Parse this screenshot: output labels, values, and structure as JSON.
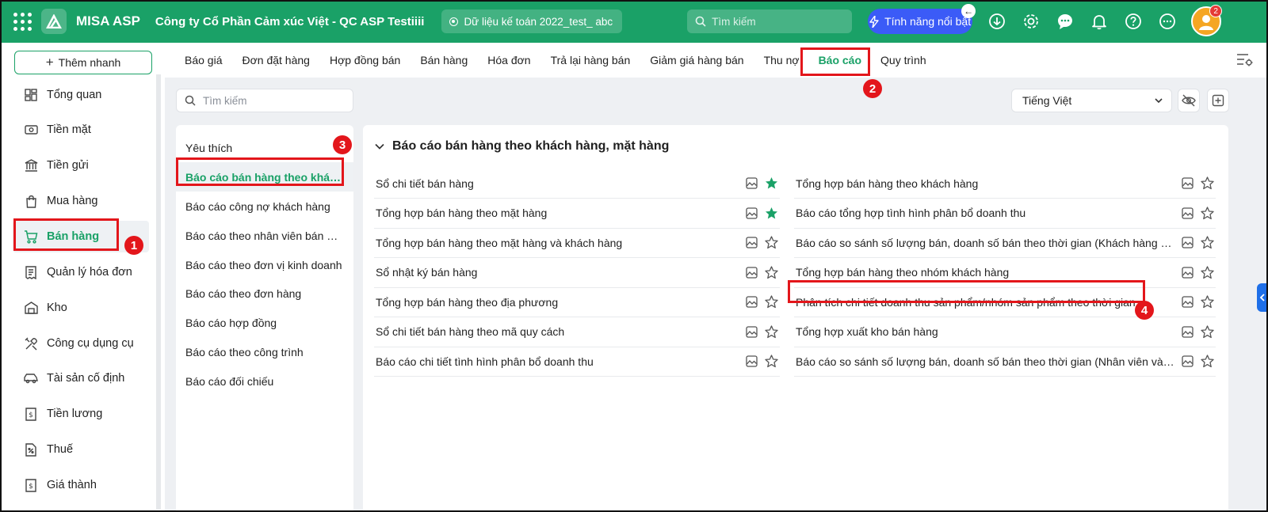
{
  "topbar": {
    "app_name": "MISA ASP",
    "company": "Công ty Cổ Phần Cảm xúc Việt - QC ASP Testiiii",
    "database": "Dữ liệu kế toán 2022_test_ abc",
    "search_placeholder": "Tìm kiếm",
    "feature_button": "Tính năng nổi bật",
    "notification_badge": "2",
    "icons": [
      "apps-icon",
      "download-icon",
      "gear-icon",
      "chat-icon",
      "bell-icon",
      "help-icon",
      "more-icon"
    ]
  },
  "sidebar": {
    "quick_add": "Thêm nhanh",
    "items": [
      {
        "label": "Tổng quan",
        "icon": "dashboard-icon"
      },
      {
        "label": "Tiền mặt",
        "icon": "cash-icon"
      },
      {
        "label": "Tiền gửi",
        "icon": "bank-icon"
      },
      {
        "label": "Mua hàng",
        "icon": "bag-icon"
      },
      {
        "label": "Bán hàng",
        "icon": "cart-icon",
        "active": true
      },
      {
        "label": "Quản lý hóa đơn",
        "icon": "invoice-icon"
      },
      {
        "label": "Kho",
        "icon": "warehouse-icon"
      },
      {
        "label": "Công cụ dụng cụ",
        "icon": "tools-icon"
      },
      {
        "label": "Tài sản cố định",
        "icon": "car-icon"
      },
      {
        "label": "Tiền lương",
        "icon": "salary-icon"
      },
      {
        "label": "Thuế",
        "icon": "tax-icon"
      },
      {
        "label": "Giá thành",
        "icon": "cost-icon"
      }
    ]
  },
  "tabs": [
    "Báo giá",
    "Đơn đặt hàng",
    "Hợp đồng bán",
    "Bán hàng",
    "Hóa đơn",
    "Trả lại hàng bán",
    "Giảm giá hàng bán",
    "Thu nợ",
    "Báo cáo",
    "Quy trình"
  ],
  "active_tab": "Báo cáo",
  "report_search_placeholder": "Tìm kiếm",
  "language": "Tiếng Việt",
  "categories": [
    "Yêu thích",
    "Báo cáo bán hàng theo khách hàng, mặt hàng",
    "Báo cáo công nợ khách hàng",
    "Báo cáo theo nhân viên bán hàng",
    "Báo cáo theo đơn vị kinh doanh",
    "Báo cáo theo đơn hàng",
    "Báo cáo hợp đồng",
    "Báo cáo theo công trình",
    "Báo cáo đối chiếu"
  ],
  "group_title": "Báo cáo bán hàng theo khách hàng, mặt hàng",
  "reports_left": [
    {
      "label": "Sổ chi tiết bán hàng",
      "favorite": true
    },
    {
      "label": "Tổng hợp bán hàng theo mặt hàng",
      "favorite": true
    },
    {
      "label": "Tổng hợp bán hàng theo mặt hàng và khách hàng",
      "favorite": false
    },
    {
      "label": "Sổ nhật ký bán hàng",
      "favorite": false
    },
    {
      "label": "Tổng hợp bán hàng theo địa phương",
      "favorite": false
    },
    {
      "label": "Sổ chi tiết bán hàng theo mã quy cách",
      "favorite": false
    },
    {
      "label": "Báo cáo chi tiết tình hình phân bổ doanh thu",
      "favorite": false
    }
  ],
  "reports_right": [
    {
      "label": "Tổng hợp bán hàng theo khách hàng",
      "favorite": false
    },
    {
      "label": "Báo cáo tổng hợp tình hình phân bổ doanh thu",
      "favorite": false
    },
    {
      "label": "Báo cáo so sánh số lượng bán, doanh số bán theo thời gian (Khách hàng và mặt hàng)",
      "favorite": false
    },
    {
      "label": "Tổng hợp bán hàng theo nhóm khách hàng",
      "favorite": false
    },
    {
      "label": "Phân tích chi tiết doanh thu sản phẩm/nhóm sản phẩm theo thời gian",
      "favorite": false
    },
    {
      "label": "Tổng hợp xuất kho bán hàng",
      "favorite": false
    },
    {
      "label": "Báo cáo so sánh số lượng bán, doanh số bán theo thời gian (Nhân viên và mặt hàng)",
      "favorite": false
    }
  ],
  "annotations": [
    "1",
    "2",
    "3",
    "4"
  ],
  "colors": {
    "brand": "#1aa167",
    "annotation": "#e3161b",
    "star_active": "#1aa167",
    "feature": "#3b5bf7"
  }
}
